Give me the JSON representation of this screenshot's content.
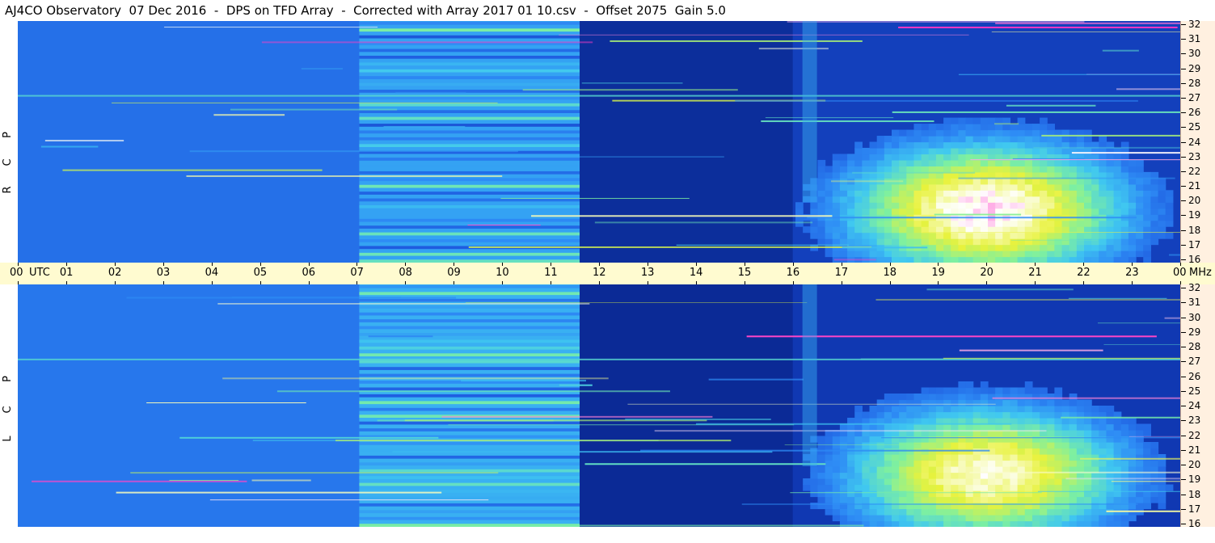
{
  "title": "AJ4CO Observatory  07 Dec 2016  -  DPS on TFD Array  -  Corrected with Array 2017 01 10.csv  -  Offset 2075  Gain 5.0",
  "chart_data": {
    "type": "heatmap",
    "title": "AJ4CO Observatory  07 Dec 2016  -  DPS on TFD Array  -  Corrected with Array 2017 01 10.csv  -  Offset 2075  Gain 5.0",
    "xlabel": "UTC",
    "ylabel": "MHz",
    "x_unit": "UTC",
    "y_unit": "MHz",
    "x_ticks": [
      "00",
      "01",
      "02",
      "03",
      "04",
      "05",
      "06",
      "07",
      "08",
      "09",
      "10",
      "11",
      "12",
      "13",
      "14",
      "15",
      "16",
      "17",
      "18",
      "19",
      "20",
      "21",
      "22",
      "23",
      "00"
    ],
    "y_ticks": [
      32,
      31,
      30,
      29,
      28,
      27,
      26,
      25,
      24,
      23,
      22,
      21,
      20,
      19,
      18,
      17,
      16
    ],
    "xlim": [
      0,
      24
    ],
    "ylim": [
      16,
      32
    ],
    "colorscale": [
      "#000033",
      "#0a2aa0",
      "#1f5de0",
      "#2e8cf5",
      "#40c8f0",
      "#7ef0a0",
      "#e8f23c",
      "#ffffff",
      "#ff30c0"
    ],
    "panels": [
      {
        "polarization": "RCP",
        "letters": [
          "R",
          "C",
          "P"
        ],
        "time_segments": [
          {
            "start": 0,
            "end": 7.05,
            "level": 0.3
          },
          {
            "start": 7.05,
            "end": 11.6,
            "level": 0.42,
            "banded": true
          },
          {
            "start": 11.6,
            "end": 24,
            "level": 0.18
          }
        ],
        "emission": {
          "center_time": 20.0,
          "center_freq": 19.5,
          "time_width": 4.5,
          "freq_width": 7.0,
          "peak": 0.9
        }
      },
      {
        "polarization": "LCP",
        "letters": [
          "L",
          "C",
          "P"
        ],
        "time_segments": [
          {
            "start": 0,
            "end": 7.05,
            "level": 0.32
          },
          {
            "start": 7.05,
            "end": 11.6,
            "level": 0.45,
            "banded": true
          },
          {
            "start": 11.6,
            "end": 24,
            "level": 0.16
          }
        ],
        "emission": {
          "center_time": 20.0,
          "center_freq": 19.5,
          "time_width": 4.5,
          "freq_width": 7.0,
          "peak": 0.85
        }
      }
    ]
  },
  "time_axis": {
    "utc_label": "UTC",
    "mhz_label": "MHz"
  }
}
